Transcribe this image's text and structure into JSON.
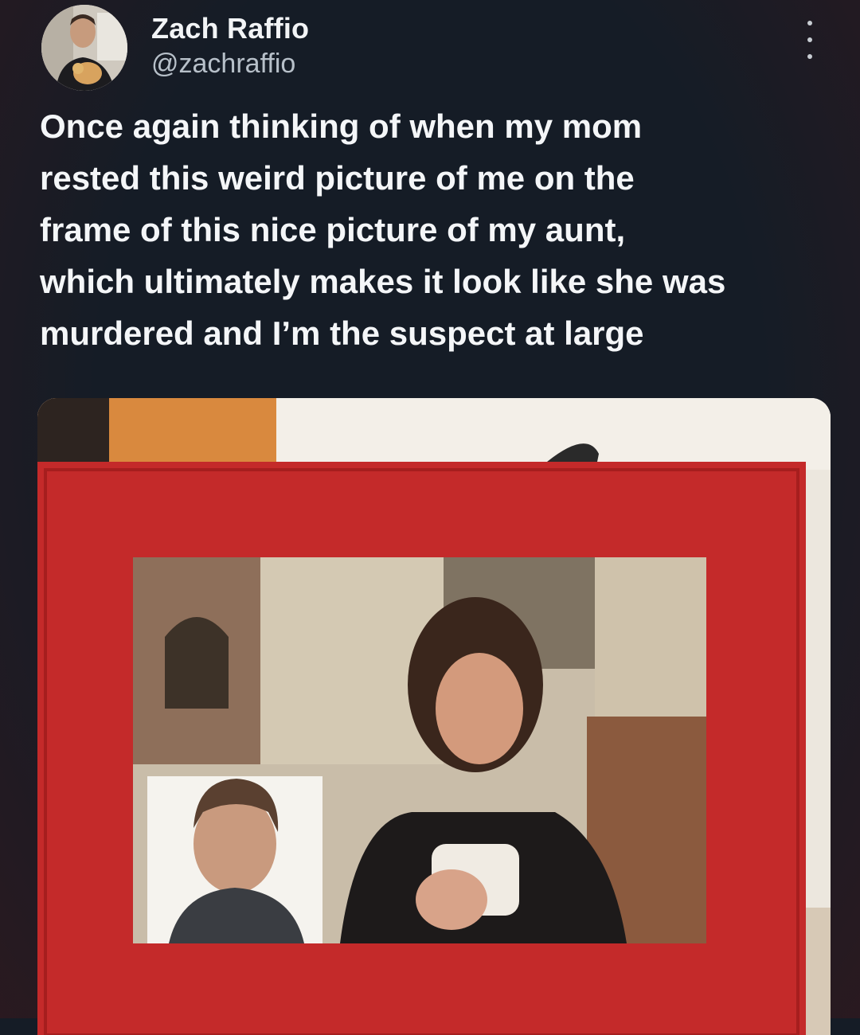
{
  "tweet": {
    "author": {
      "display_name": "Zach Raffio",
      "handle": "@zachraffio",
      "avatar_icon": "profile-photo"
    },
    "more_icon": "more-vertical-icon",
    "text": "Once again thinking of when my mom\nrested this weird picture of me on the\nframe of this nice picture of my aunt,\nwhich ultimately makes it look like she was\nmurdered and I’m the suspect at large",
    "media": {
      "description_icon": "photo-red-frame",
      "frame_color": "#c42a2a"
    }
  },
  "colors": {
    "background": "#151c26",
    "text": "#f4f6f8",
    "handle": "#b7c0c9"
  }
}
